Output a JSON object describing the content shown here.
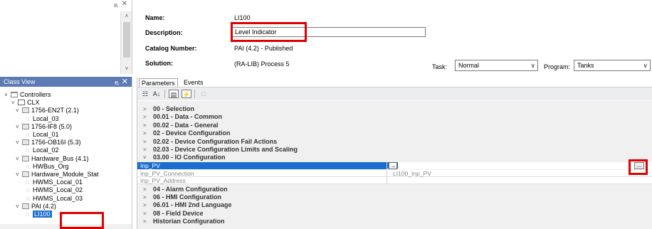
{
  "top_left_pane": {
    "pin": "ⱸ",
    "close": "✕",
    "scroll_up": "˄",
    "scroll_down": "˅"
  },
  "class_view": {
    "title": "Class View",
    "pin": "ⱸ",
    "close": "✕",
    "tree": [
      {
        "toggle": "˅",
        "icon": "folder-icon",
        "label": "Controllers"
      },
      {
        "toggle": "˅",
        "icon": "controller-icon",
        "label": "CLX"
      },
      {
        "toggle": "˅",
        "icon": "module-icon",
        "label": "1756-EN2T   (2.1)"
      },
      {
        "toggle": "",
        "icon": "instance-icon",
        "label": "Local_03"
      },
      {
        "toggle": "˅",
        "icon": "module-icon",
        "label": "1756-IF8   (5.0)"
      },
      {
        "toggle": "",
        "icon": "instance-icon",
        "label": "Local_01"
      },
      {
        "toggle": "˅",
        "icon": "module-icon",
        "label": "1756-OB16I   (5.3)"
      },
      {
        "toggle": "",
        "icon": "instance-icon",
        "label": "Local_02"
      },
      {
        "toggle": "˅",
        "icon": "module-icon",
        "label": "Hardware_Bus   (4.1)"
      },
      {
        "toggle": "",
        "icon": "instance-icon",
        "label": "HWBus_Org"
      },
      {
        "toggle": "˅",
        "icon": "module-icon",
        "label": "Hardware_Module_Stat"
      },
      {
        "toggle": "",
        "icon": "instance-icon",
        "label": "HWMS_Local_01"
      },
      {
        "toggle": "",
        "icon": "instance-icon",
        "label": "HWMS_Local_02"
      },
      {
        "toggle": "",
        "icon": "instance-icon",
        "label": "HWMS_Local_03"
      },
      {
        "toggle": "˅",
        "icon": "module-icon",
        "label": "PAI   (4.2)"
      },
      {
        "toggle": "",
        "icon": "instance-icon",
        "label": "LI100",
        "selected": true
      }
    ]
  },
  "properties": {
    "name_label": "Name:",
    "name_value": "LI100",
    "description_label": "Description:",
    "description_value": "Level Indicator",
    "catalog_label": "Catalog Number:",
    "catalog_value": "PAI   (4.2)  -  Published",
    "solution_label": "Solution:",
    "solution_value": "(RA-LIB) Process 5",
    "task_label": "Task:",
    "task_value": "Normal",
    "program_label": "Program:",
    "program_value": "Tanks",
    "dropdown_glyph": "∨"
  },
  "grid": {
    "tabs": [
      "Parameters",
      "Events"
    ],
    "toolbar": {
      "categorized": "☷",
      "sort_az": "A↓",
      "property_pages": "▤",
      "events": "⚡",
      "extra": "□"
    },
    "groups_before": [
      {
        "toggle": ">",
        "label": "00 - Selection"
      },
      {
        "toggle": ">",
        "label": "00.01 - Data - Common"
      },
      {
        "toggle": ">",
        "label": "00.02 - Data - General"
      },
      {
        "toggle": ">",
        "label": "02 - Device Configuration"
      },
      {
        "toggle": ">",
        "label": "02.02 - Device Configuration Fail Actions"
      },
      {
        "toggle": ">",
        "label": "02.03 - Device Configuration Limits and Scaling"
      },
      {
        "toggle": "˅",
        "label": "03.00 - IO Configuration"
      }
    ],
    "params": [
      {
        "name": "Inp_PV",
        "value": "",
        "value_button": "→",
        "selected": true,
        "ellipsis": "..."
      },
      {
        "name": "Inp_PV_Connection",
        "value": "LI100_Inp_PV"
      },
      {
        "name": "Inp_PV_Address",
        "value": ""
      }
    ],
    "groups_after": [
      {
        "toggle": ">",
        "label": "04 - Alarm Configuration"
      },
      {
        "toggle": ">",
        "label": "06 - HMI Configuration"
      },
      {
        "toggle": ">",
        "label": "06.01 - HMI 2nd Language"
      },
      {
        "toggle": ">",
        "label": "08 - Field Device"
      },
      {
        "toggle": ">",
        "label": "Historian Configuration"
      }
    ]
  },
  "colors": {
    "caption_bg": "#5c7ab3",
    "selection": "#1c6dd0",
    "highlight_box": "#e00000"
  }
}
